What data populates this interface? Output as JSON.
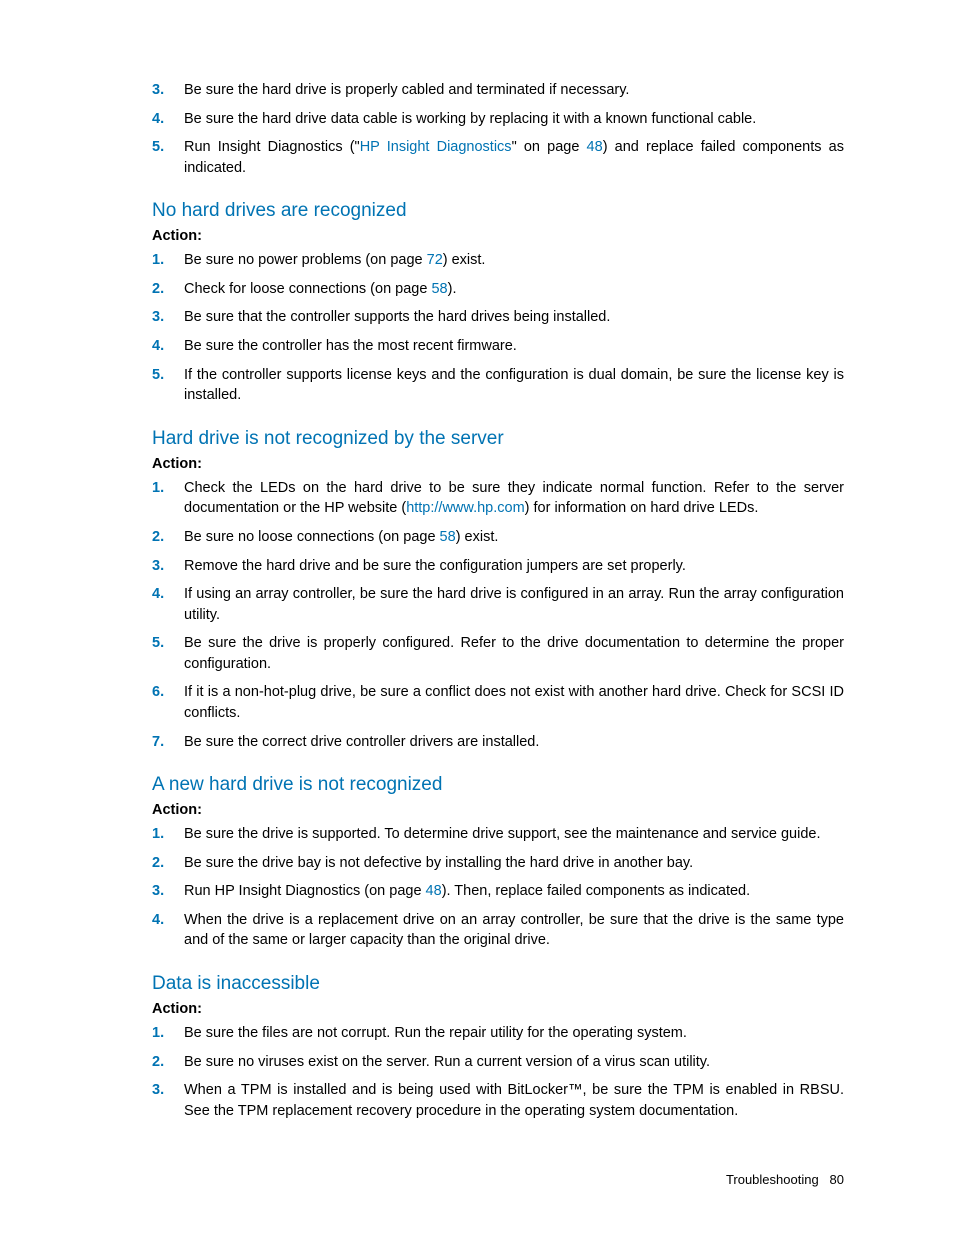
{
  "topList": {
    "start": 3,
    "items": [
      {
        "segments": [
          {
            "t": "Be sure the hard drive is properly cabled and terminated if necessary."
          }
        ]
      },
      {
        "segments": [
          {
            "t": "Be sure the hard drive data cable is working by replacing it with a known functional cable."
          }
        ]
      },
      {
        "segments": [
          {
            "t": "Run Insight Diagnostics (\""
          },
          {
            "t": "HP Insight Diagnostics",
            "link": true
          },
          {
            "t": "\" on page "
          },
          {
            "t": "48",
            "link": true
          },
          {
            "t": ") and replace failed components as indicated."
          }
        ]
      }
    ]
  },
  "sections": [
    {
      "heading": "No hard drives are recognized",
      "action": "Action",
      "items": [
        {
          "segments": [
            {
              "t": "Be sure no power problems (on page "
            },
            {
              "t": "72",
              "link": true
            },
            {
              "t": ") exist."
            }
          ]
        },
        {
          "segments": [
            {
              "t": "Check for loose connections (on page "
            },
            {
              "t": "58",
              "link": true
            },
            {
              "t": ")."
            }
          ]
        },
        {
          "segments": [
            {
              "t": "Be sure that the controller supports the hard drives being installed."
            }
          ]
        },
        {
          "segments": [
            {
              "t": "Be sure the controller has the most recent firmware."
            }
          ]
        },
        {
          "segments": [
            {
              "t": "If the controller supports license keys and the configuration is dual domain, be sure the license key is installed."
            }
          ]
        }
      ]
    },
    {
      "heading": "Hard drive is not recognized by the server",
      "action": "Action",
      "items": [
        {
          "segments": [
            {
              "t": "Check the LEDs on the hard drive to be sure they indicate normal function. Refer to the server documentation or the HP website ("
            },
            {
              "t": "http://www.hp.com",
              "link": true
            },
            {
              "t": ") for information on hard drive LEDs."
            }
          ]
        },
        {
          "segments": [
            {
              "t": "Be sure no loose connections (on page "
            },
            {
              "t": "58",
              "link": true
            },
            {
              "t": ") exist."
            }
          ]
        },
        {
          "segments": [
            {
              "t": "Remove the hard drive and be sure the configuration jumpers are set properly."
            }
          ]
        },
        {
          "segments": [
            {
              "t": "If using an array controller, be sure the hard drive is configured in an array. Run the array configuration utility."
            }
          ]
        },
        {
          "segments": [
            {
              "t": "Be sure the drive is properly configured. Refer to the drive documentation to determine the proper configuration."
            }
          ]
        },
        {
          "segments": [
            {
              "t": "If it is a non-hot-plug drive, be sure a conflict does not exist with another hard drive. Check for SCSI ID conflicts."
            }
          ]
        },
        {
          "segments": [
            {
              "t": "Be sure the correct drive controller drivers are installed."
            }
          ]
        }
      ]
    },
    {
      "heading": "A new hard drive is not recognized",
      "action": "Action",
      "items": [
        {
          "segments": [
            {
              "t": "Be sure the drive is supported. To determine drive support, see the maintenance and service guide."
            }
          ]
        },
        {
          "segments": [
            {
              "t": "Be sure the drive bay is not defective by installing the hard drive in another bay."
            }
          ]
        },
        {
          "segments": [
            {
              "t": "Run HP Insight Diagnostics (on page "
            },
            {
              "t": "48",
              "link": true
            },
            {
              "t": "). Then, replace failed components as indicated."
            }
          ]
        },
        {
          "segments": [
            {
              "t": "When the drive is a replacement drive on an array controller, be sure that the drive is the same type and of the same or larger capacity than the original drive."
            }
          ]
        }
      ]
    },
    {
      "heading": "Data is inaccessible",
      "action": "Action",
      "items": [
        {
          "segments": [
            {
              "t": "Be sure the files are not corrupt. Run the repair utility for the operating system."
            }
          ]
        },
        {
          "segments": [
            {
              "t": "Be sure no viruses exist on the server. Run a current version of a virus scan utility."
            }
          ]
        },
        {
          "segments": [
            {
              "t": "When a TPM is installed and is being used with BitLocker™, be sure the TPM is enabled in RBSU. See the TPM replacement recovery procedure in the operating system documentation."
            }
          ]
        }
      ]
    }
  ],
  "footer": {
    "label": "Troubleshooting",
    "page": "80"
  }
}
